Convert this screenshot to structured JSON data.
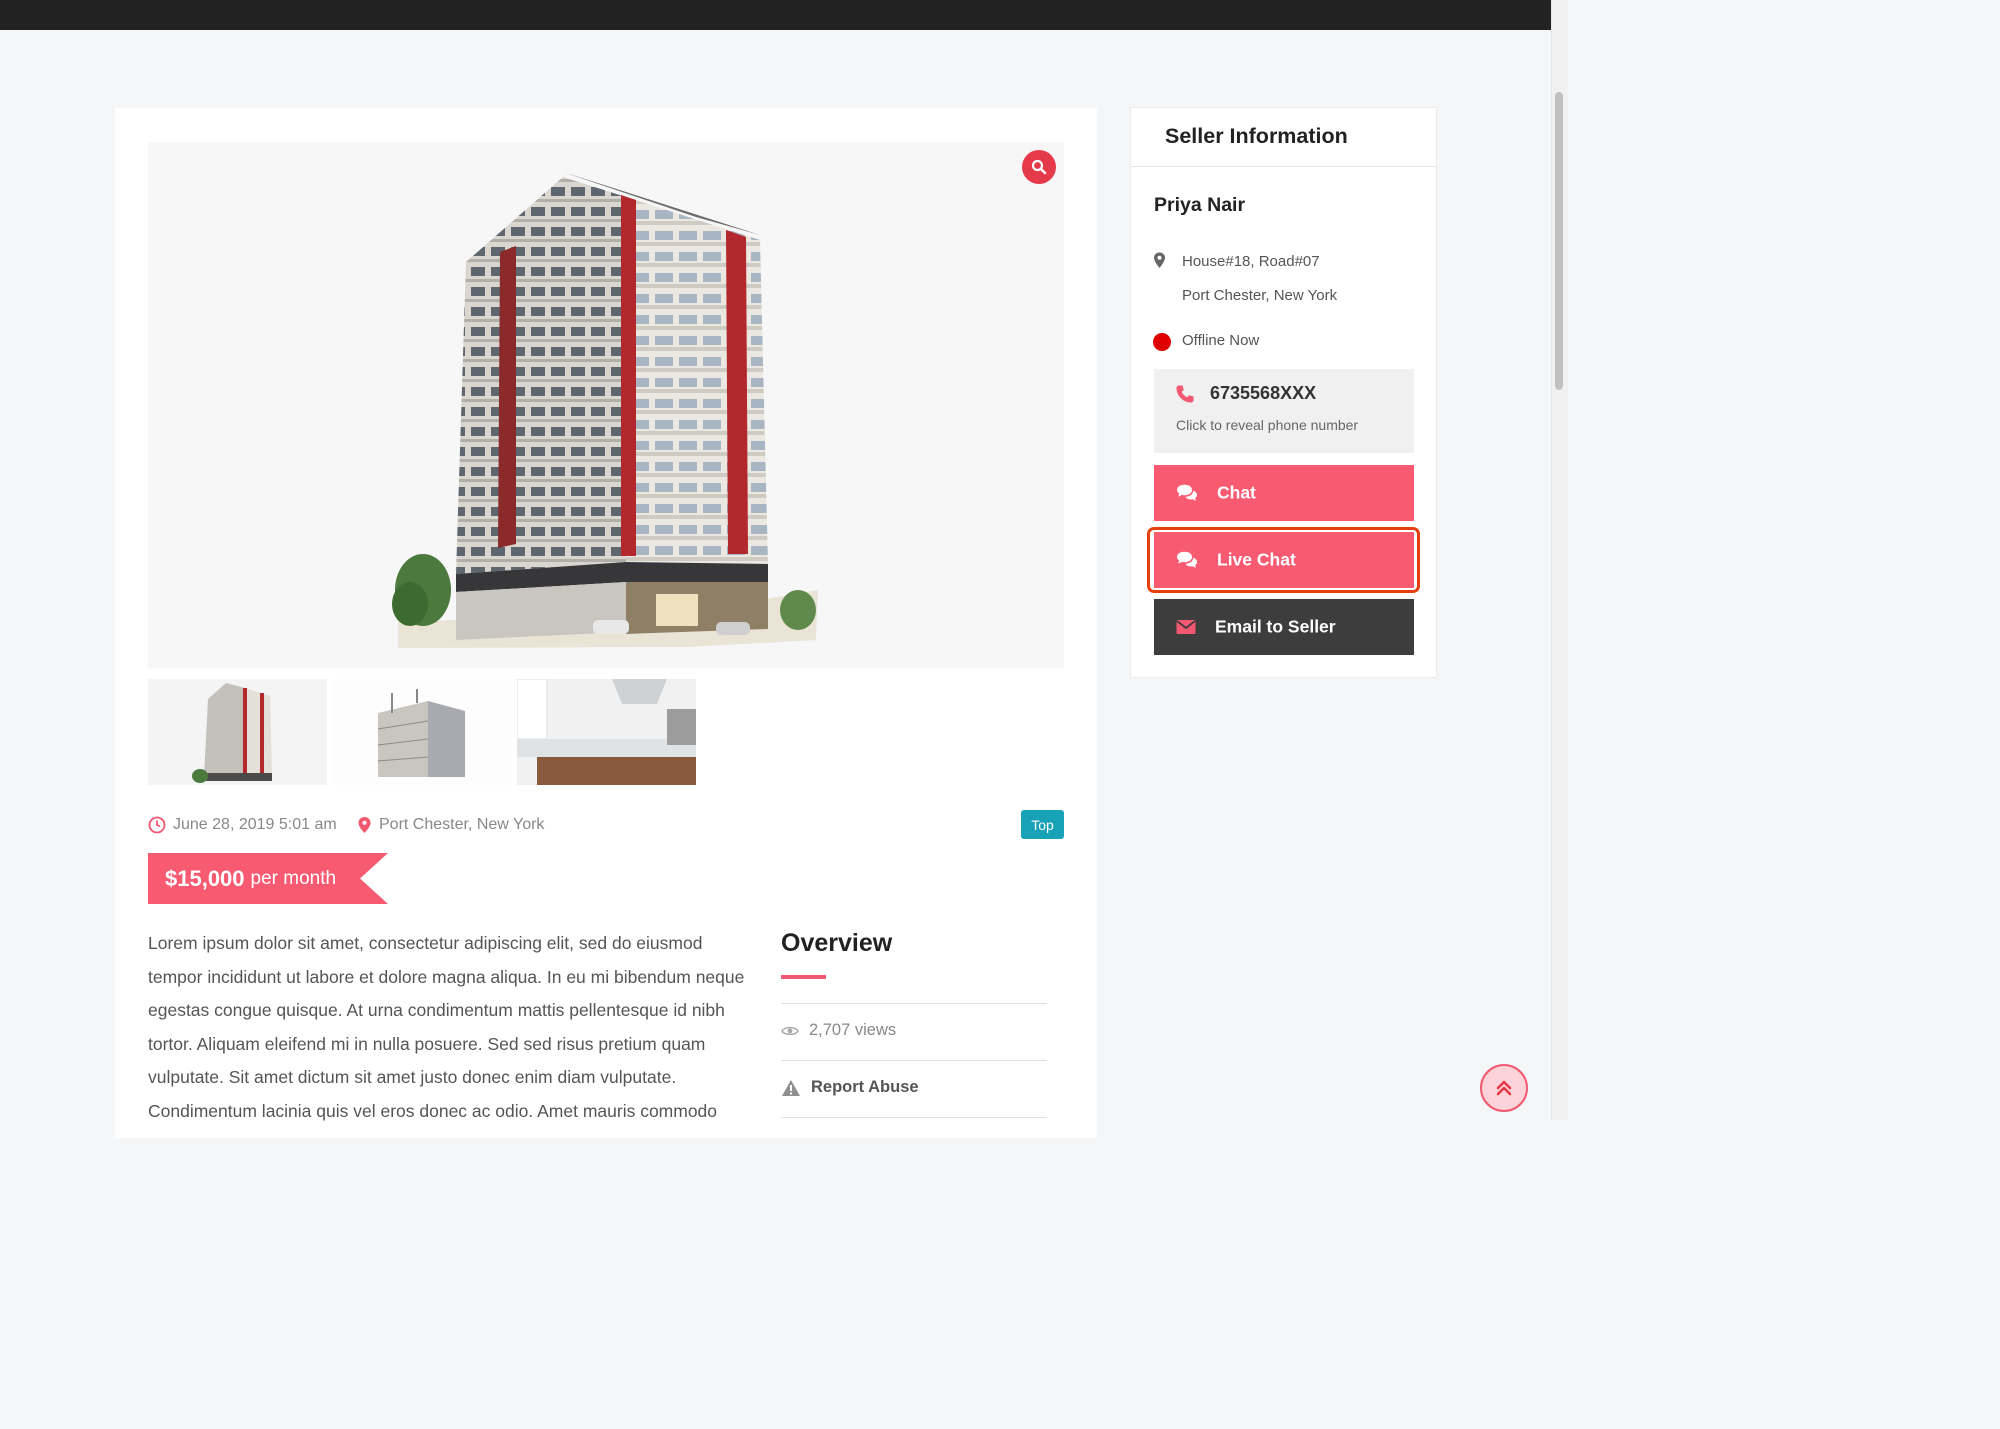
{
  "listing": {
    "date": "June 28, 2019 5:01 am",
    "location": "Port Chester, New York",
    "badge": "Top",
    "price": {
      "amount": "$15,000",
      "unit": "per month"
    },
    "description": "Lorem ipsum dolor sit amet, consectetur adipiscing elit, sed do eiusmod tempor incididunt ut labore et dolore magna aliqua. In eu mi bibendum neque egestas congue quisque. At urna condimentum mattis pellentesque id nibh tortor. Aliquam eleifend mi in nulla posuere. Sed sed risus pretium quam vulputate. Sit amet dictum sit amet justo donec enim diam vulputate. Condimentum lacinia quis vel eros donec ac odio. Amet mauris commodo"
  },
  "overview": {
    "title": "Overview",
    "views": "2,707 views",
    "report": "Report Abuse"
  },
  "seller": {
    "heading": "Seller Information",
    "name": "Priya Nair",
    "address_line1": "House#18, Road#07",
    "address_line2": "Port Chester, New York",
    "status": "Offline Now",
    "phone": "6735568XXX",
    "phone_hint": "Click to reveal phone number",
    "chat_label": "Chat",
    "live_chat_label": "Live Chat",
    "email_label": "Email to Seller"
  },
  "icons": {
    "zoom": "search-icon",
    "date": "clock-icon",
    "location": "map-pin-icon",
    "views": "eye-icon",
    "report": "warning-icon",
    "phone": "phone-icon",
    "chat": "comments-icon",
    "email": "envelope-icon",
    "back_to_top": "double-chevron-up-icon"
  },
  "colors": {
    "accent": "#f85b71",
    "danger": "#e53a4a",
    "badge": "#17a2b8",
    "dark_button": "#3d3d3d",
    "status_offline": "#e00000"
  }
}
